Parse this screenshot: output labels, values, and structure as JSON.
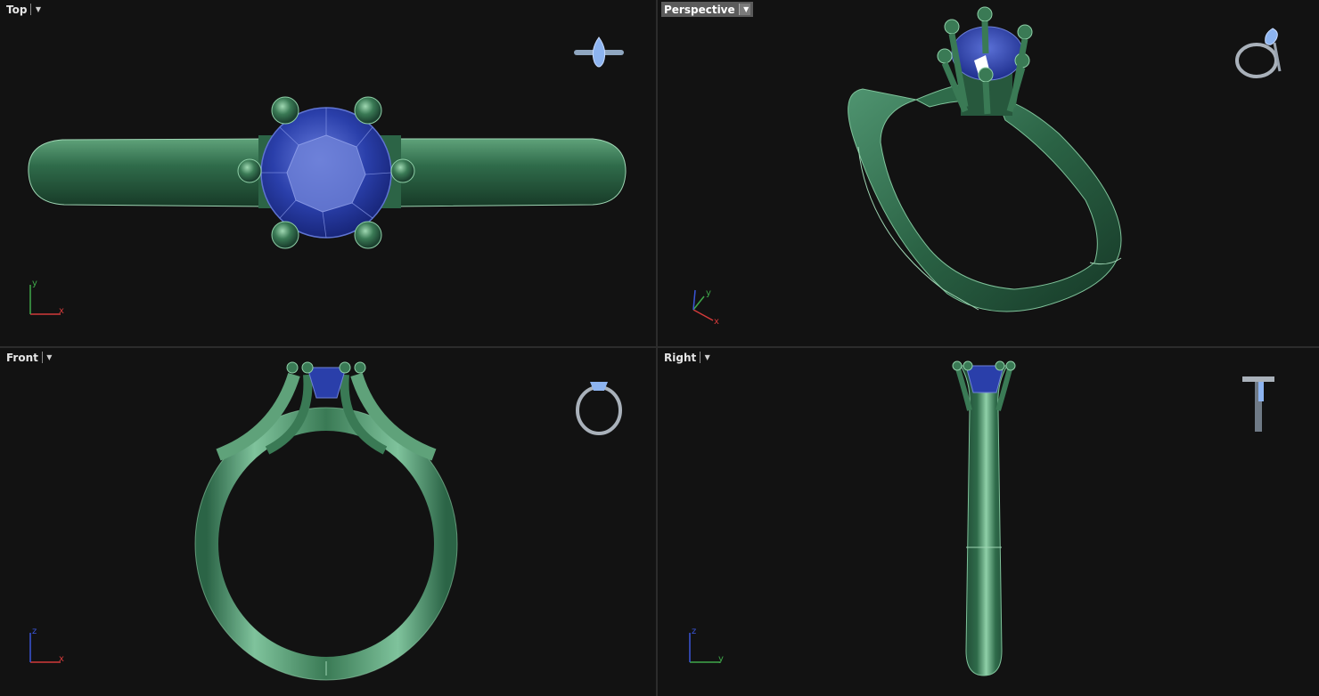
{
  "viewports": {
    "top": {
      "label": "Top",
      "active": false,
      "axes": {
        "h": "x",
        "v": "y"
      }
    },
    "persp": {
      "label": "Perspective",
      "active": true,
      "axes": {
        "h": "x",
        "v": "y"
      }
    },
    "front": {
      "label": "Front",
      "active": false,
      "axes": {
        "h": "x",
        "v": "z"
      }
    },
    "right": {
      "label": "Right",
      "active": false,
      "axes": {
        "h": "y",
        "v": "z"
      }
    }
  },
  "colors": {
    "background": "#121212",
    "metal": "#2f6b4a",
    "metal_highlight": "#8fd0a8",
    "gem": "#2a3faa",
    "gem_highlight": "#7c8ee0",
    "axis_x": "#d23a3a",
    "axis_y": "#3fa84a",
    "axis_z": "#3a55d8"
  },
  "icons": {
    "viewport_menu": "chevron-down-icon",
    "thumbnail": "ring-preview-icon"
  }
}
